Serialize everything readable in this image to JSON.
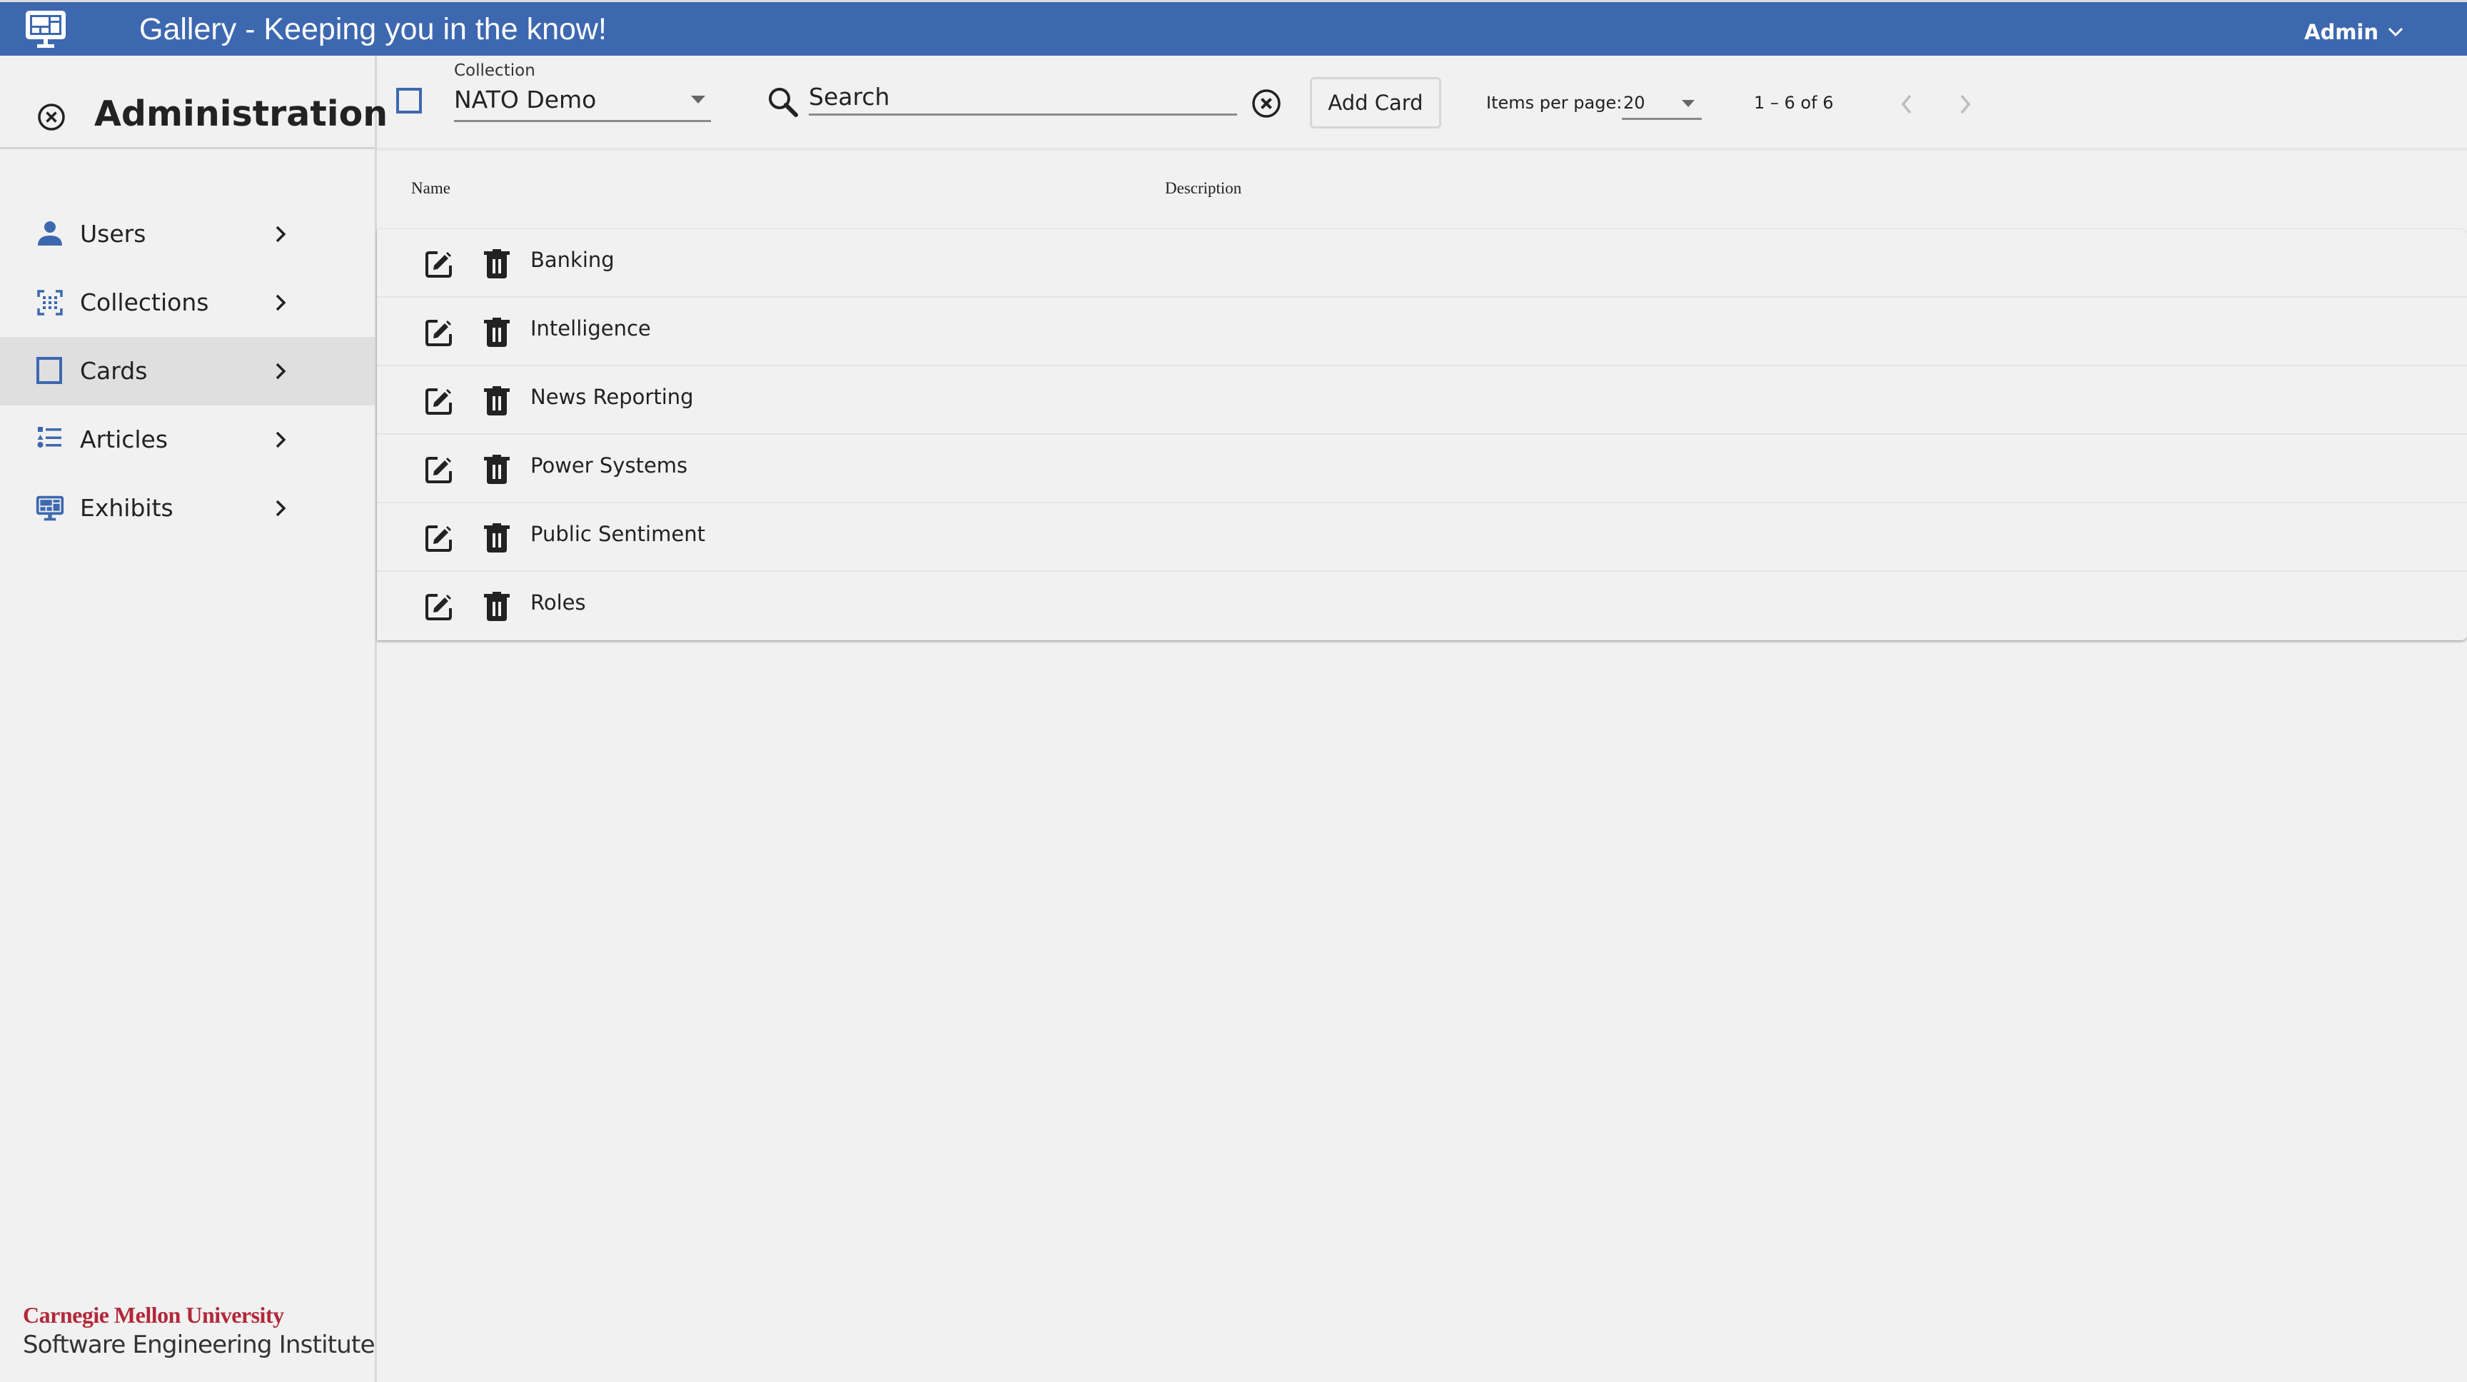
{
  "app": {
    "title": "Gallery - Keeping you in the know!",
    "logo_icon": "monitor-dashboard-icon",
    "brand_color": "#3d68b0",
    "user": {
      "name": "Admin",
      "menu_icon": "chevron-down-icon"
    }
  },
  "sidebar": {
    "title": "Administration",
    "close_icon": "close-circle-icon",
    "items": [
      {
        "label": "Users",
        "icon": "person-icon",
        "selected": false
      },
      {
        "label": "Collections",
        "icon": "collections-grid-icon",
        "selected": false
      },
      {
        "label": "Cards",
        "icon": "card-square-icon",
        "selected": true
      },
      {
        "label": "Articles",
        "icon": "list-icon",
        "selected": false
      },
      {
        "label": "Exhibits",
        "icon": "monitor-dashboard-icon",
        "selected": false
      }
    ],
    "footer": {
      "university": "Carnegie Mellon University",
      "institute": "Software Engineering Institute",
      "university_color": "#b2283a"
    }
  },
  "toolbar": {
    "collection": {
      "label": "Collection",
      "value": "NATO Demo"
    },
    "search": {
      "placeholder": "Search",
      "value": ""
    },
    "add_button": "Add Card",
    "paginator": {
      "items_per_page_label": "Items per page:",
      "items_per_page": "20",
      "range": "1 – 6 of 6"
    }
  },
  "table": {
    "columns": [
      "Name",
      "Description"
    ],
    "rows": [
      {
        "name": "Banking",
        "description": ""
      },
      {
        "name": "Intelligence",
        "description": ""
      },
      {
        "name": "News Reporting",
        "description": ""
      },
      {
        "name": "Power Systems",
        "description": ""
      },
      {
        "name": "Public Sentiment",
        "description": ""
      },
      {
        "name": "Roles",
        "description": ""
      }
    ]
  }
}
